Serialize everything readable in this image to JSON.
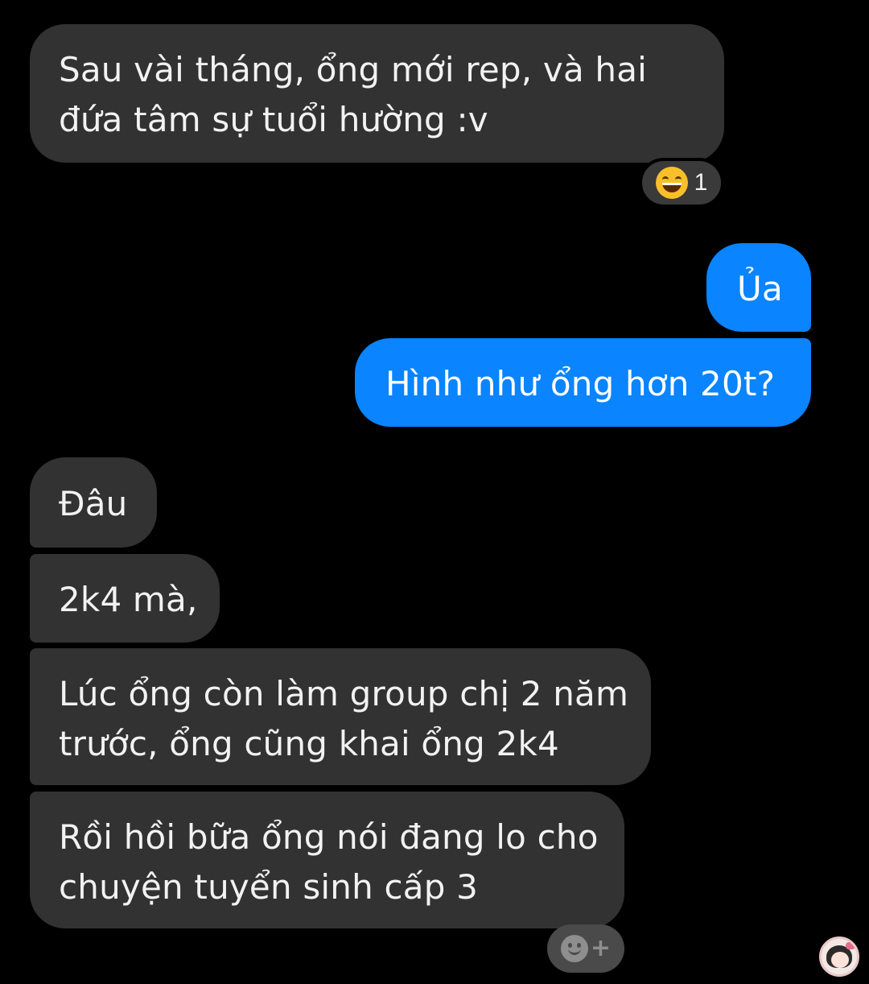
{
  "messages": [
    {
      "direction": "incoming",
      "lines": [
        "Sau vài tháng, ổng mới rep, và hai",
        "đứa tâm sự tuổi hường :v"
      ]
    },
    {
      "direction": "outgoing",
      "lines": [
        "Ủa"
      ]
    },
    {
      "direction": "outgoing",
      "lines": [
        "Hình như ổng hơn 20t?"
      ]
    },
    {
      "direction": "incoming",
      "lines": [
        "Đâu"
      ]
    },
    {
      "direction": "incoming",
      "lines": [
        "2k4 mà,"
      ]
    },
    {
      "direction": "incoming",
      "lines": [
        "Lúc ổng còn làm group chị 2 năm",
        "trước, ổng cũng khai ổng 2k4"
      ]
    },
    {
      "direction": "incoming",
      "lines": [
        "Rồi hồi bữa ổng nói đang lo cho",
        "chuyện tuyển sinh cấp 3"
      ]
    }
  ],
  "reaction": {
    "icon": "laughing-emoji-icon",
    "count": "1"
  },
  "add_reaction": {
    "icon": "smiley-plus-icon",
    "label": "+"
  },
  "seen_avatar": {
    "icon": "avatar-icon"
  },
  "colors": {
    "background": "#000000",
    "incoming_bubble": "#323232",
    "outgoing_bubble": "#0a84ff",
    "text": "#f2f2f2"
  }
}
